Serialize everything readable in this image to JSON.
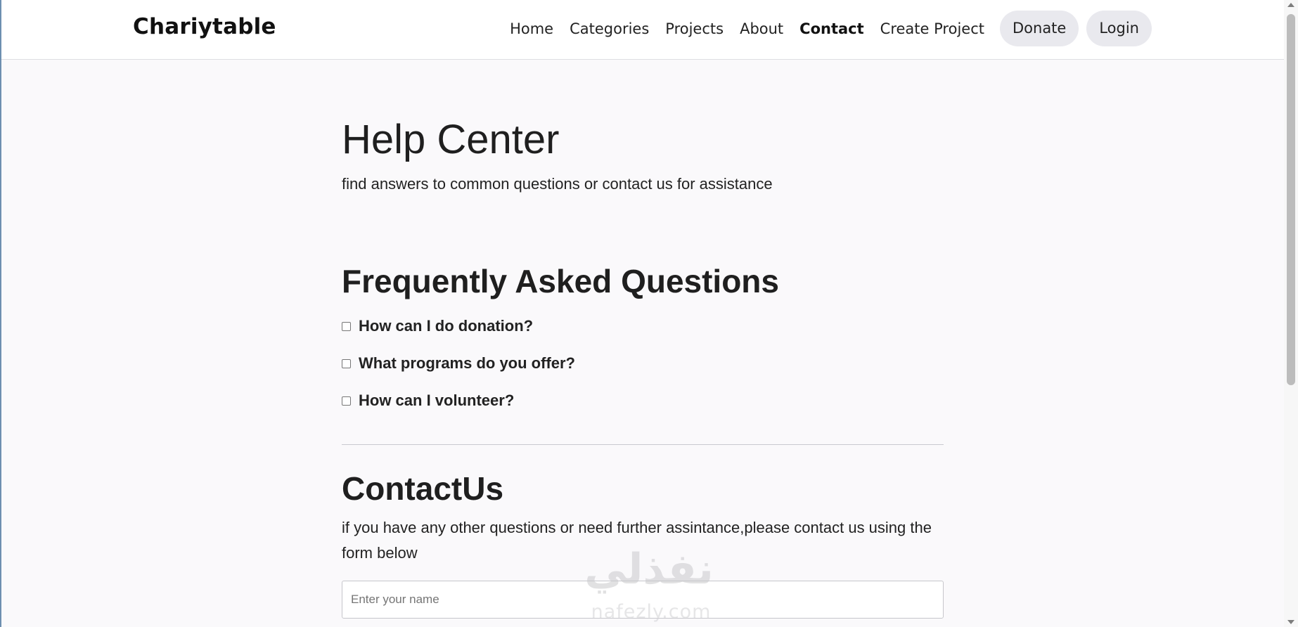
{
  "brand": "Chariytable",
  "nav": {
    "links": [
      "Home",
      "Categories",
      "Projects",
      "About",
      "Contact",
      "Create Project"
    ],
    "active": "Contact",
    "donate_label": "Donate",
    "login_label": "Login"
  },
  "help": {
    "title": "Help Center",
    "subtitle": "find answers to common questions or contact us for assistance"
  },
  "faq": {
    "title": "Frequently Asked Questions",
    "questions": [
      "How can I do donation?",
      "What programs do you offer?",
      "How can I volunteer?"
    ]
  },
  "contact": {
    "title": "ContactUs",
    "text": "if you have any other questions or need further assintance,please contact us using the form below",
    "name_placeholder": "Enter your name"
  },
  "watermark": {
    "arabic": "نفذلي",
    "latin": "nafezly.com"
  }
}
